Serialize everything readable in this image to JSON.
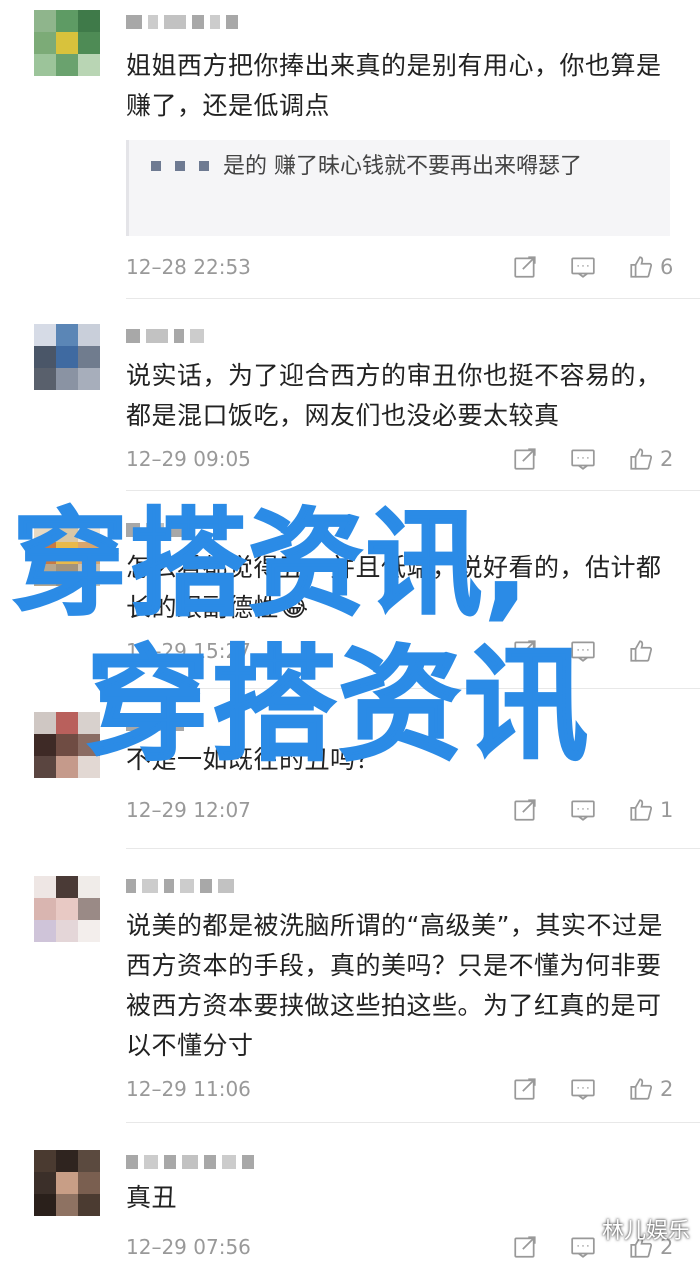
{
  "comments": [
    {
      "text": "姐姐西方把你捧出来真的是别有用心，你也算是赚了，还是低调点",
      "quote": "是的 赚了昧心钱就不要再出来嘚瑟了",
      "time": "12–28 22:53",
      "likes": "6"
    },
    {
      "text": "说实话，为了迎合西方的审丑你也挺不容易的，都是混口饭吃，网友们也没必要太较真",
      "time": "12–29 09:05",
      "likes": "2"
    },
    {
      "text": "怎么看都觉得丑，并且低端，说好看的，估计都长的跟副德性😂",
      "time": "12–29 15:27",
      "likes": ""
    },
    {
      "text": "不是一如既往的丑吗？",
      "time": "12–29 12:07",
      "likes": "1"
    },
    {
      "text": "说美的都是被洗脑所谓的“高级美”，其实不过是西方资本的手段，真的美吗？只是不懂为何非要被西方资本要挟做这些拍这些。为了红真的是可以不懂分寸",
      "time": "12–29 11:06",
      "likes": "2"
    },
    {
      "text": "真丑",
      "time": "12–29 07:56",
      "likes": "2"
    }
  ],
  "overlay": {
    "line1": "穿搭资讯,",
    "line2": "穿搭资讯"
  },
  "watermark": "林儿娱乐",
  "colors": {
    "overlay_text": "#2b8be6",
    "meta_text": "#999999",
    "body_text": "#222222"
  },
  "icons": [
    "share-icon",
    "reply-icon",
    "thumbs-up-icon"
  ]
}
